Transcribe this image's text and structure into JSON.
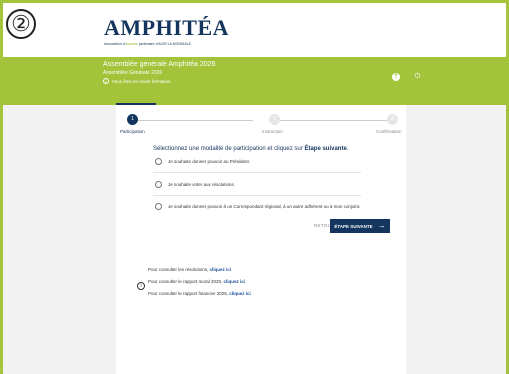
{
  "badge": "②",
  "brand": {
    "logo_text": "AMPHITÉA",
    "tagline_pre": "Association d'",
    "tagline_accent": "assurés",
    "tagline_post": " partenaire d'AGIR LA MONDIALE"
  },
  "header": {
    "title": "Assemblée générale Amphitéa 2026",
    "subtitle": "Assemblée Générale 2026",
    "info_icon": "i",
    "info": "Vous êtes en mode formation",
    "help_icon": "?",
    "power_icon": "⏻"
  },
  "stepper": {
    "steps": [
      {
        "num": "1",
        "label": "Participation"
      },
      {
        "num": "2",
        "label": "Instruction"
      },
      {
        "num": "3",
        "label": "Confirmation"
      }
    ]
  },
  "form": {
    "prompt_pre": "Sélectionnez une modalité de participation et cliquez sur ",
    "prompt_bold": "Étape suivante",
    "prompt_post": ".",
    "options": [
      "Je souhaite donner pouvoir au Président.",
      "Je souhaite voter aux résolutions.",
      "Je souhaite donner pouvoir à un Correspondant régional, à un autre adhérent ou à mon conjoint."
    ],
    "back_label": "RETOUR",
    "next_label": "ÉTAPE SUIVANTE",
    "next_arrow": "→"
  },
  "links": {
    "info_icon": "i",
    "rows": [
      {
        "text": "Pour consulter les résolutions, ",
        "link": "cliquez ici"
      },
      {
        "text": "Pour consulter le rapport moral 2025, ",
        "link": "cliquez ici"
      },
      {
        "text": "Pour consulter le rapport financier 2025, ",
        "link": "cliquez ici"
      }
    ]
  },
  "colors": {
    "green": "#a3c33a",
    "navy": "#14355e",
    "link": "#1a4f9c"
  }
}
